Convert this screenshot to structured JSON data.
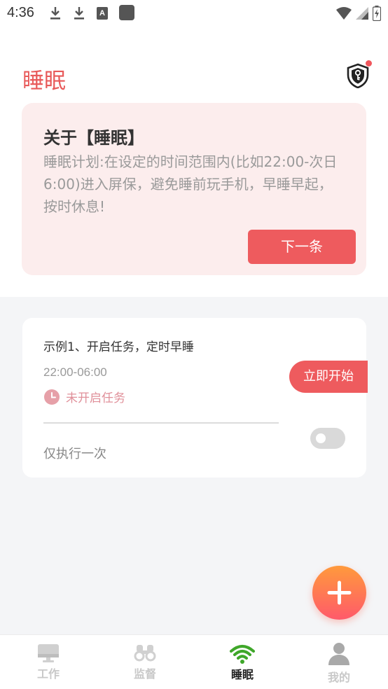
{
  "status_bar": {
    "time": "4:36",
    "icons": [
      "download-icon",
      "download-icon",
      "font-icon",
      "app-square-icon",
      "wifi-icon",
      "signal-icon",
      "battery-icon"
    ],
    "font_letter": "A"
  },
  "header": {
    "title": "睡眠",
    "icon": "shield-key-icon",
    "notification_dot_color": "#f0565c"
  },
  "about": {
    "title": "关于【睡眠】",
    "text": "睡眠计划:在设定的时间范围内(比如22:00-次日6:00)进入屏保，避免睡前玩手机，早睡早起，按时休息!",
    "next_label": "下一条"
  },
  "task": {
    "name": "示例1、开启任务，定时早睡",
    "time_range": "22:00-06:00",
    "status": "未开启任务",
    "start_label": "立即开始",
    "repeat_label": "仅执行一次",
    "toggle_on": false
  },
  "fab": {
    "icon": "plus-icon"
  },
  "nav": {
    "items": [
      {
        "label": "工作",
        "icon": "monitor-icon",
        "active": false
      },
      {
        "label": "监督",
        "icon": "binoculars-icon",
        "active": false
      },
      {
        "label": "睡眠",
        "icon": "wifi-icon",
        "active": true
      },
      {
        "label": "我的",
        "icon": "user-icon",
        "active": false
      }
    ]
  },
  "colors": {
    "accent": "#ee5b5e",
    "title": "#e85a5a",
    "card_bg": "#fceded",
    "nav_active_icon": "#3fa72a"
  }
}
